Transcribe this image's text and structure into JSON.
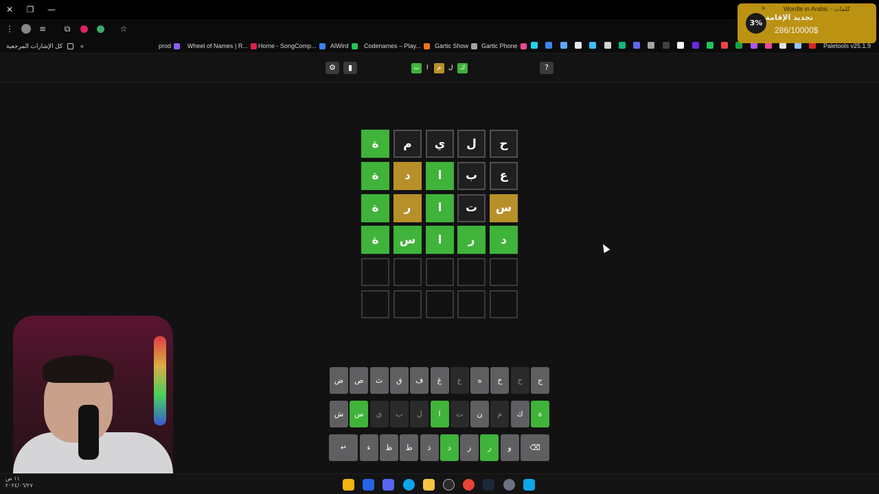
{
  "browser": {
    "bookmarks_folder": "كل الإشارات المرجعية",
    "bookmarks": [
      {
        "label": "prod",
        "color": "#8b5cf6"
      },
      {
        "label": "Wheel of Names | R...",
        "color": "#e11d48"
      },
      {
        "label": "Home - SongComp...",
        "color": "#3b82f6"
      },
      {
        "label": "AlWird",
        "color": "#22c55e"
      },
      {
        "label": "Codenames – Play...",
        "color": "#f97316"
      },
      {
        "label": "Gartic Show",
        "color": "#a3a3a3"
      },
      {
        "label": "Gartic Phone",
        "color": "#ec4899"
      },
      {
        "label": "Paletools v25.1.9",
        "color": "#9ca3af"
      }
    ]
  },
  "overlay": {
    "title": "Wordle in Arabic - كلمات",
    "subtitle": "تجديد الإقامة",
    "percent": "3%",
    "amount": "286/10000$"
  },
  "game": {
    "settings_icon": "gear-icon",
    "stats_icon": "stats-icon",
    "help_label": "?",
    "logo": [
      {
        "ch": "ك",
        "state": "correct"
      },
      {
        "ch": "ل",
        "state": "plain"
      },
      {
        "ch": "م",
        "state": "present"
      },
      {
        "ch": "ا",
        "state": "plain"
      },
      {
        "ch": "ت",
        "state": "correct"
      }
    ],
    "board": [
      [
        {
          "ch": "ح",
          "s": "absent"
        },
        {
          "ch": "ل",
          "s": "absent"
        },
        {
          "ch": "ي",
          "s": "absent"
        },
        {
          "ch": "م",
          "s": "absent"
        },
        {
          "ch": "ة",
          "s": "correct"
        }
      ],
      [
        {
          "ch": "ع",
          "s": "absent"
        },
        {
          "ch": "ب",
          "s": "absent"
        },
        {
          "ch": "ا",
          "s": "correct"
        },
        {
          "ch": "د",
          "s": "present"
        },
        {
          "ch": "ة",
          "s": "correct"
        }
      ],
      [
        {
          "ch": "س",
          "s": "present"
        },
        {
          "ch": "ت",
          "s": "absent"
        },
        {
          "ch": "ا",
          "s": "correct"
        },
        {
          "ch": "ر",
          "s": "present"
        },
        {
          "ch": "ة",
          "s": "correct"
        }
      ],
      [
        {
          "ch": "د",
          "s": "correct"
        },
        {
          "ch": "ر",
          "s": "correct"
        },
        {
          "ch": "ا",
          "s": "correct"
        },
        {
          "ch": "س",
          "s": "correct"
        },
        {
          "ch": "ة",
          "s": "correct"
        }
      ],
      [
        {
          "ch": "",
          "s": "empty"
        },
        {
          "ch": "",
          "s": "empty"
        },
        {
          "ch": "",
          "s": "empty"
        },
        {
          "ch": "",
          "s": "empty"
        },
        {
          "ch": "",
          "s": "empty"
        }
      ],
      [
        {
          "ch": "",
          "s": "empty"
        },
        {
          "ch": "",
          "s": "empty"
        },
        {
          "ch": "",
          "s": "empty"
        },
        {
          "ch": "",
          "s": "empty"
        },
        {
          "ch": "",
          "s": "empty"
        }
      ]
    ],
    "keyboard": [
      [
        {
          "k": "ج",
          "s": "plain"
        },
        {
          "k": "ح",
          "s": "absent"
        },
        {
          "k": "خ",
          "s": "plain"
        },
        {
          "k": "ه",
          "s": "plain"
        },
        {
          "k": "ع",
          "s": "absent"
        },
        {
          "k": "غ",
          "s": "plain"
        },
        {
          "k": "ف",
          "s": "plain"
        },
        {
          "k": "ق",
          "s": "plain"
        },
        {
          "k": "ث",
          "s": "plain"
        },
        {
          "k": "ص",
          "s": "plain"
        },
        {
          "k": "ض",
          "s": "plain"
        }
      ],
      [
        {
          "k": "ة",
          "s": "correct"
        },
        {
          "k": "ك",
          "s": "plain"
        },
        {
          "k": "م",
          "s": "absent"
        },
        {
          "k": "ن",
          "s": "plain"
        },
        {
          "k": "ت",
          "s": "absent"
        },
        {
          "k": "ا",
          "s": "correct"
        },
        {
          "k": "ل",
          "s": "absent"
        },
        {
          "k": "ب",
          "s": "absent"
        },
        {
          "k": "ي",
          "s": "absent"
        },
        {
          "k": "س",
          "s": "correct"
        },
        {
          "k": "ش",
          "s": "plain"
        }
      ],
      [
        {
          "k": "⌫",
          "s": "plain",
          "wide": true
        },
        {
          "k": "و",
          "s": "plain"
        },
        {
          "k": "ر",
          "s": "correct"
        },
        {
          "k": "ز",
          "s": "plain"
        },
        {
          "k": "د",
          "s": "correct"
        },
        {
          "k": "ذ",
          "s": "plain"
        },
        {
          "k": "ط",
          "s": "plain"
        },
        {
          "k": "ظ",
          "s": "plain"
        },
        {
          "k": "ء",
          "s": "plain"
        },
        {
          "k": "↵",
          "s": "plain",
          "wide": true
        }
      ]
    ]
  },
  "taskbar": {
    "clock_time": "١١ ص",
    "clock_date": "٢٠٢٤/٠٦/٢٧"
  }
}
